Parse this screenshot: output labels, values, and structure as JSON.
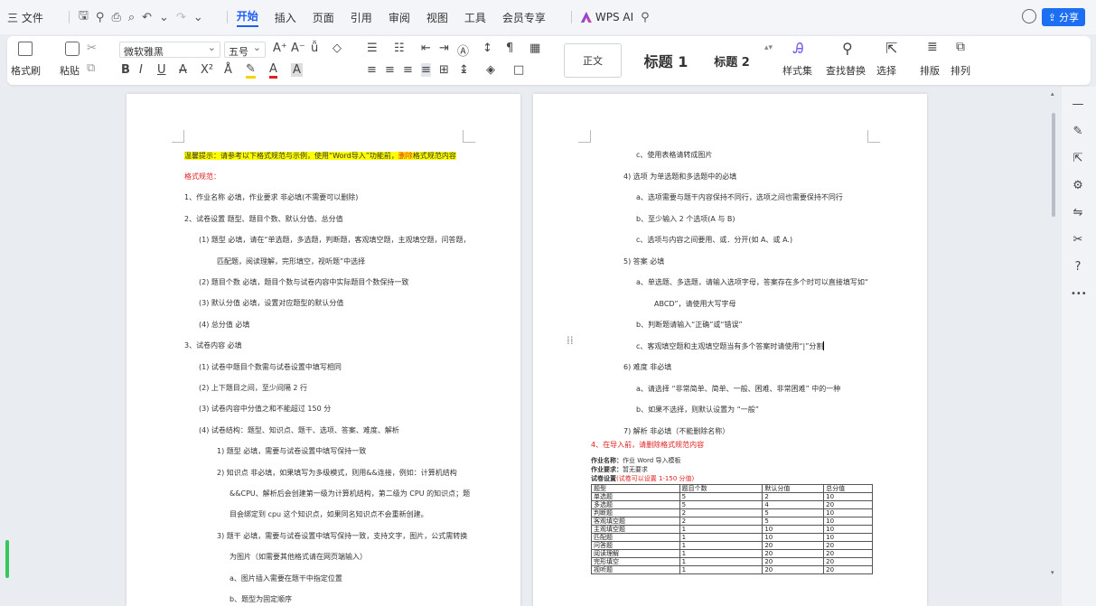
{
  "menubar": {
    "file": "三 文件",
    "undo_dropdown": "⌄",
    "tabs": [
      "开始",
      "插入",
      "页面",
      "引用",
      "审阅",
      "视图",
      "工具",
      "会员专享"
    ],
    "wps_ai": "WPS AI",
    "share": "分享"
  },
  "ribbon": {
    "format_painter": "格式刷",
    "paste": "粘贴",
    "font_name": "微软雅黑",
    "font_size": "五号",
    "styles": {
      "normal": "正文",
      "heading1": "标题 1",
      "heading2": "标题 2"
    },
    "style_set": "样式集",
    "find_replace": "查找替换",
    "select": "选择",
    "layout": "排版",
    "arrange": "排列"
  },
  "page_left": {
    "tip": "温馨提示：请参考以下格式规范与示例，使用“Word导入”功能前，",
    "tip_delete": "删除",
    "tip_end": "格式规范内容",
    "lines": [
      {
        "text": "格式规范：",
        "indent": 0,
        "red": true
      },
      {
        "text": "1、作业名称 必填，作业要求 非必填(不需要可以删除)",
        "indent": 0
      },
      {
        "text": "2、试卷设置 题型、题目个数、默认分值、总分值",
        "indent": 0
      },
      {
        "text": "(1) 题型 必填，请在“单选题，多选题，判断题，客观填空题，主观填空题，问答题，",
        "indent": 1
      },
      {
        "text": "匹配题，阅读理解，完形填空，视听题”中选择",
        "indent": 2
      },
      {
        "text": "(2) 题目个数 必填，题目个数与试卷内容中实际题目个数保持一致",
        "indent": 1
      },
      {
        "text": "(3) 默认分值 必填，设置对应题型的默认分值",
        "indent": 1
      },
      {
        "text": "(4) 总分值 必填",
        "indent": 1
      },
      {
        "text": "3、试卷内容 必填",
        "indent": 0
      },
      {
        "text": "(1) 试卷中题目个数需与试卷设置中填写相同",
        "indent": 1
      },
      {
        "text": "(2) 上下题目之间，至少间隔 2 行",
        "indent": 1
      },
      {
        "text": "(3) 试卷内容中分值之和不能超过 150 分",
        "indent": 1
      },
      {
        "text": "(4) 试卷结构：题型、知识点、题干、选项、答案、难度、解析",
        "indent": 1
      },
      {
        "text": "1) 题型 必填，需要与试卷设置中填写保持一致",
        "indent": 2
      },
      {
        "text": "2) 知识点 非必填，如果填写为多级模式，则用&&连接，例如：计算机结构",
        "indent": 2
      },
      {
        "text": "&&CPU、解析后会创建第一级为计算机结构，第二级为 CPU 的知识点；题",
        "indent": 3
      },
      {
        "text": "目会绑定到 cpu 这个知识点，如果同名知识点不会重新创建。",
        "indent": 3
      },
      {
        "text": "3) 题干 必填，需要与试卷设置中填写保持一致，支持文字，图片，公式需转换",
        "indent": 2
      },
      {
        "text": "为图片（如需要其他格式请在网页端输入）",
        "indent": 3
      },
      {
        "text": "a、图片插入需要在题干中指定位置",
        "indent": 3
      },
      {
        "text": "b、题型为固定顺序",
        "indent": 3
      }
    ]
  },
  "page_right": {
    "lines": [
      {
        "text": "c、使用表格请转成图片",
        "indent": 3
      },
      {
        "text": "4) 选项 为单选题和多选题中的必填",
        "indent": 2
      },
      {
        "text": "a、选项需要与题干内容保持不同行，选项之间也需要保持不同行",
        "indent": 3
      },
      {
        "text": "b、至少输入 2 个选项(A 与 B)",
        "indent": 3
      },
      {
        "text": "c、选项与内容之间要用、或．分开(如 A、或 A.)",
        "indent": 3
      },
      {
        "text": "5) 答案 必填",
        "indent": 2
      },
      {
        "text": "a、单选题、多选题，请输入选项字母，答案存在多个时可以直接填写如“",
        "indent": 3
      },
      {
        "text": "ABCD”，请使用大写字母",
        "indent": 4
      },
      {
        "text": "b、判断题请输入“正确”或“错误”",
        "indent": 3
      },
      {
        "text": "c、客观填空题和主观填空题当有多个答案时请使用“|”分割",
        "indent": 3
      },
      {
        "text": "6) 难度 非必填",
        "indent": 2
      },
      {
        "text": "a、请选择 “非常简单、简单、一般、困难、非常困难” 中的一种",
        "indent": 3
      },
      {
        "text": "b、如果不选择，则默认设置为 “一般”",
        "indent": 3
      },
      {
        "text": "7) 解析 非必填（不能删除名称）",
        "indent": 2
      }
    ],
    "red_heading": "4、在导入前，请删除格式规范内容",
    "hw_name_label": "作业名称：",
    "hw_name": "作业 Word 导入模板",
    "hw_req_label": "作业要求：",
    "hw_req": "暂无要求",
    "exam_label": "试卷设置",
    "exam_note": "(试卷可以设置 1-150 分值)",
    "table": [
      [
        "题型",
        "题目个数",
        "默认分值",
        "总分值"
      ],
      [
        "单选题",
        "5",
        "2",
        "10"
      ],
      [
        "多选题",
        "5",
        "4",
        "20"
      ],
      [
        "判断题",
        "2",
        "5",
        "10"
      ],
      [
        "客观填空题",
        "2",
        "5",
        "10"
      ],
      [
        "主观填空题",
        "1",
        "10",
        "10"
      ],
      [
        "匹配题",
        "1",
        "10",
        "10"
      ],
      [
        "问答题",
        "1",
        "20",
        "20"
      ],
      [
        "阅读理解",
        "1",
        "20",
        "20"
      ],
      [
        "完形填空",
        "1",
        "20",
        "20"
      ],
      [
        "视听题",
        "1",
        "20",
        "20"
      ]
    ]
  },
  "sidebar": {
    "icons": [
      "minus-icon",
      "pen-icon",
      "cursor-icon",
      "settings-icon",
      "translate-icon",
      "tools-icon",
      "help-icon",
      "more-icon"
    ]
  }
}
